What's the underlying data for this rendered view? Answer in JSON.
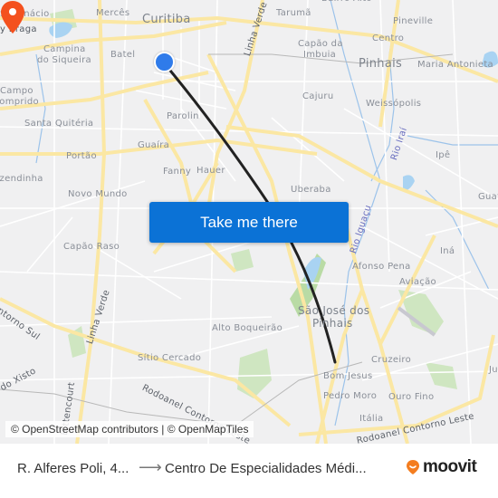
{
  "map": {
    "labels": {
      "sao_inacio": "São Inácio",
      "mercês": "Mercês",
      "curitiba": "Curitiba",
      "taruma": "Tarumã",
      "bairro_alto": "Bairro Alto",
      "pineville": "Pineville",
      "bigorrilho_braga": "y Braga",
      "campina_siqueira_1": "Campina",
      "campina_siqueira_2": "do Siqueira",
      "batel": "Batel",
      "capao_imbuia_1": "Capão da",
      "capao_imbuia_2": "Imbuia",
      "centro": "Centro",
      "pinhais": "Pinhais",
      "maria_antonieta": "Maria Antonieta",
      "campo_comprido_1": "Campo",
      "campo_comprido_2": "Comprido",
      "linha_verde_top": "Linha Verde",
      "cajuru": "Cajuru",
      "parolin": "Parolin",
      "weissopolis": "Weissópolis",
      "santa_quiteria": "Santa Quitéria",
      "guaira": "Guaíra",
      "rio_irai": "Rio Iraí",
      "ipe": "Ipê",
      "portao": "Portão",
      "fazendinha": "Fazendinha",
      "fanny": "Fanny",
      "hauer": "Hauer",
      "novo_mundo": "Novo Mundo",
      "uberaba": "Uberaba",
      "guatupe": "Guatupê",
      "rio_iguacu": "Rio Iguaçu",
      "capao_raso": "Capão Raso",
      "ina": "Iná",
      "afonso_pena": "Afonso Pena",
      "aviacao": "Aviação",
      "contorno_sul": "Contorno Sul",
      "linha_verde_bottom": "Linha Verde",
      "sao_jose_1": "São José dos",
      "sao_jose_2": "Pinhais",
      "alto_boqueirao": "Alto Boqueirão",
      "sitio_cercado": "Sítio Cercado",
      "cruzeiro": "Cruzeiro",
      "xisto": "Estrada do Xisto",
      "bittencourt": "Bittencourt",
      "bom_jesus": "Bom Jesus",
      "pedro_moro": "Pedro Moro",
      "ouro_fino": "Ouro Fino",
      "rodoanel_west": "Rodoanel Contorno Leste",
      "italia": "Itália",
      "rodoanel_east": "Rodoanel Contorno Leste",
      "ju": "Ju"
    },
    "cta_label": "Take me there",
    "attribution": "© OpenStreetMap contributors | © OpenMapTiles",
    "colors": {
      "origin": "#2f7bea",
      "destination": "#f4511e",
      "route": "#222222",
      "cta": "#0b72d6",
      "major_road": "#fbe7a3",
      "water": "#a9d3f2",
      "park": "#cfe6c1"
    }
  },
  "footer": {
    "from": "R. Alferes Poli, 4...",
    "arrow": "⟶",
    "to": "Centro De Especialidades Médi...",
    "brand": "moovit"
  }
}
